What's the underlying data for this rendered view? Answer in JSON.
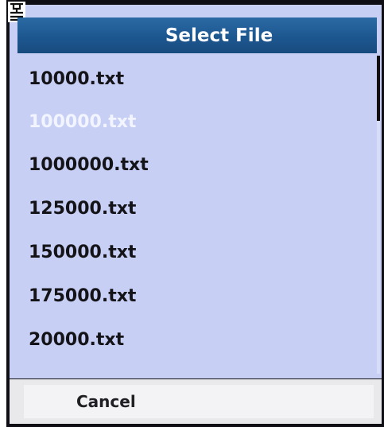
{
  "dialog": {
    "title": "Select File"
  },
  "status": {
    "icon": "signal-antenna-icon"
  },
  "files": [
    {
      "name": "10000.txt",
      "selected": false
    },
    {
      "name": "100000.txt",
      "selected": true
    },
    {
      "name": "1000000.txt",
      "selected": false
    },
    {
      "name": "125000.txt",
      "selected": false
    },
    {
      "name": "150000.txt",
      "selected": false
    },
    {
      "name": "175000.txt",
      "selected": false
    },
    {
      "name": "20000.txt",
      "selected": false
    }
  ],
  "softkeys": {
    "cancel_label": "Cancel"
  },
  "colors": {
    "title_bar": "#1d5790",
    "list_background": "#c7cff5",
    "selected_text": "#f2f4ff",
    "text": "#141418"
  }
}
